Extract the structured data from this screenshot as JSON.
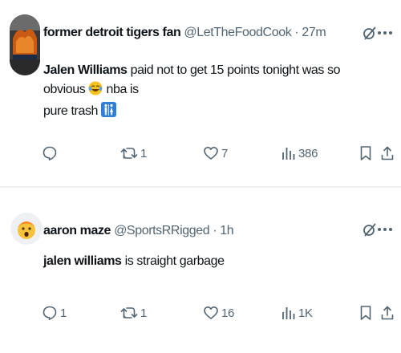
{
  "tweets": [
    {
      "author": {
        "display_name": "former detroit tigers fan",
        "handle": "@LetTheFoodCook",
        "time": "27m"
      },
      "text": {
        "mention": "Jalen Williams",
        "rest_line1": " paid not to get 15 points tonight was so obvious ",
        "after_emoji": " nba is",
        "line2": "pure trash "
      },
      "icons": [
        "grok-icon",
        "more-icon",
        "reply-icon",
        "retweet-icon",
        "like-icon",
        "views-icon",
        "bookmark-icon",
        "share-icon",
        "joy-emoji",
        "restroom-emoji"
      ],
      "stats": {
        "replies": "",
        "retweets": "1",
        "likes": "7",
        "views": "386"
      }
    },
    {
      "author": {
        "display_name": "aaron maze",
        "handle": "@SportsRRigged",
        "time": "1h"
      },
      "text": {
        "mention": "jalen williams",
        "rest_line1": " is straight garbage"
      },
      "icons": [
        "grok-icon",
        "more-icon",
        "reply-icon",
        "retweet-icon",
        "like-icon",
        "views-icon",
        "bookmark-icon",
        "share-icon"
      ],
      "stats": {
        "replies": "1",
        "retweets": "1",
        "likes": "16",
        "views": "1K"
      }
    }
  ],
  "separator": "·",
  "colors": {
    "text_primary": "#0f1419",
    "text_secondary": "#536471",
    "divider": "#e6e6e6"
  }
}
